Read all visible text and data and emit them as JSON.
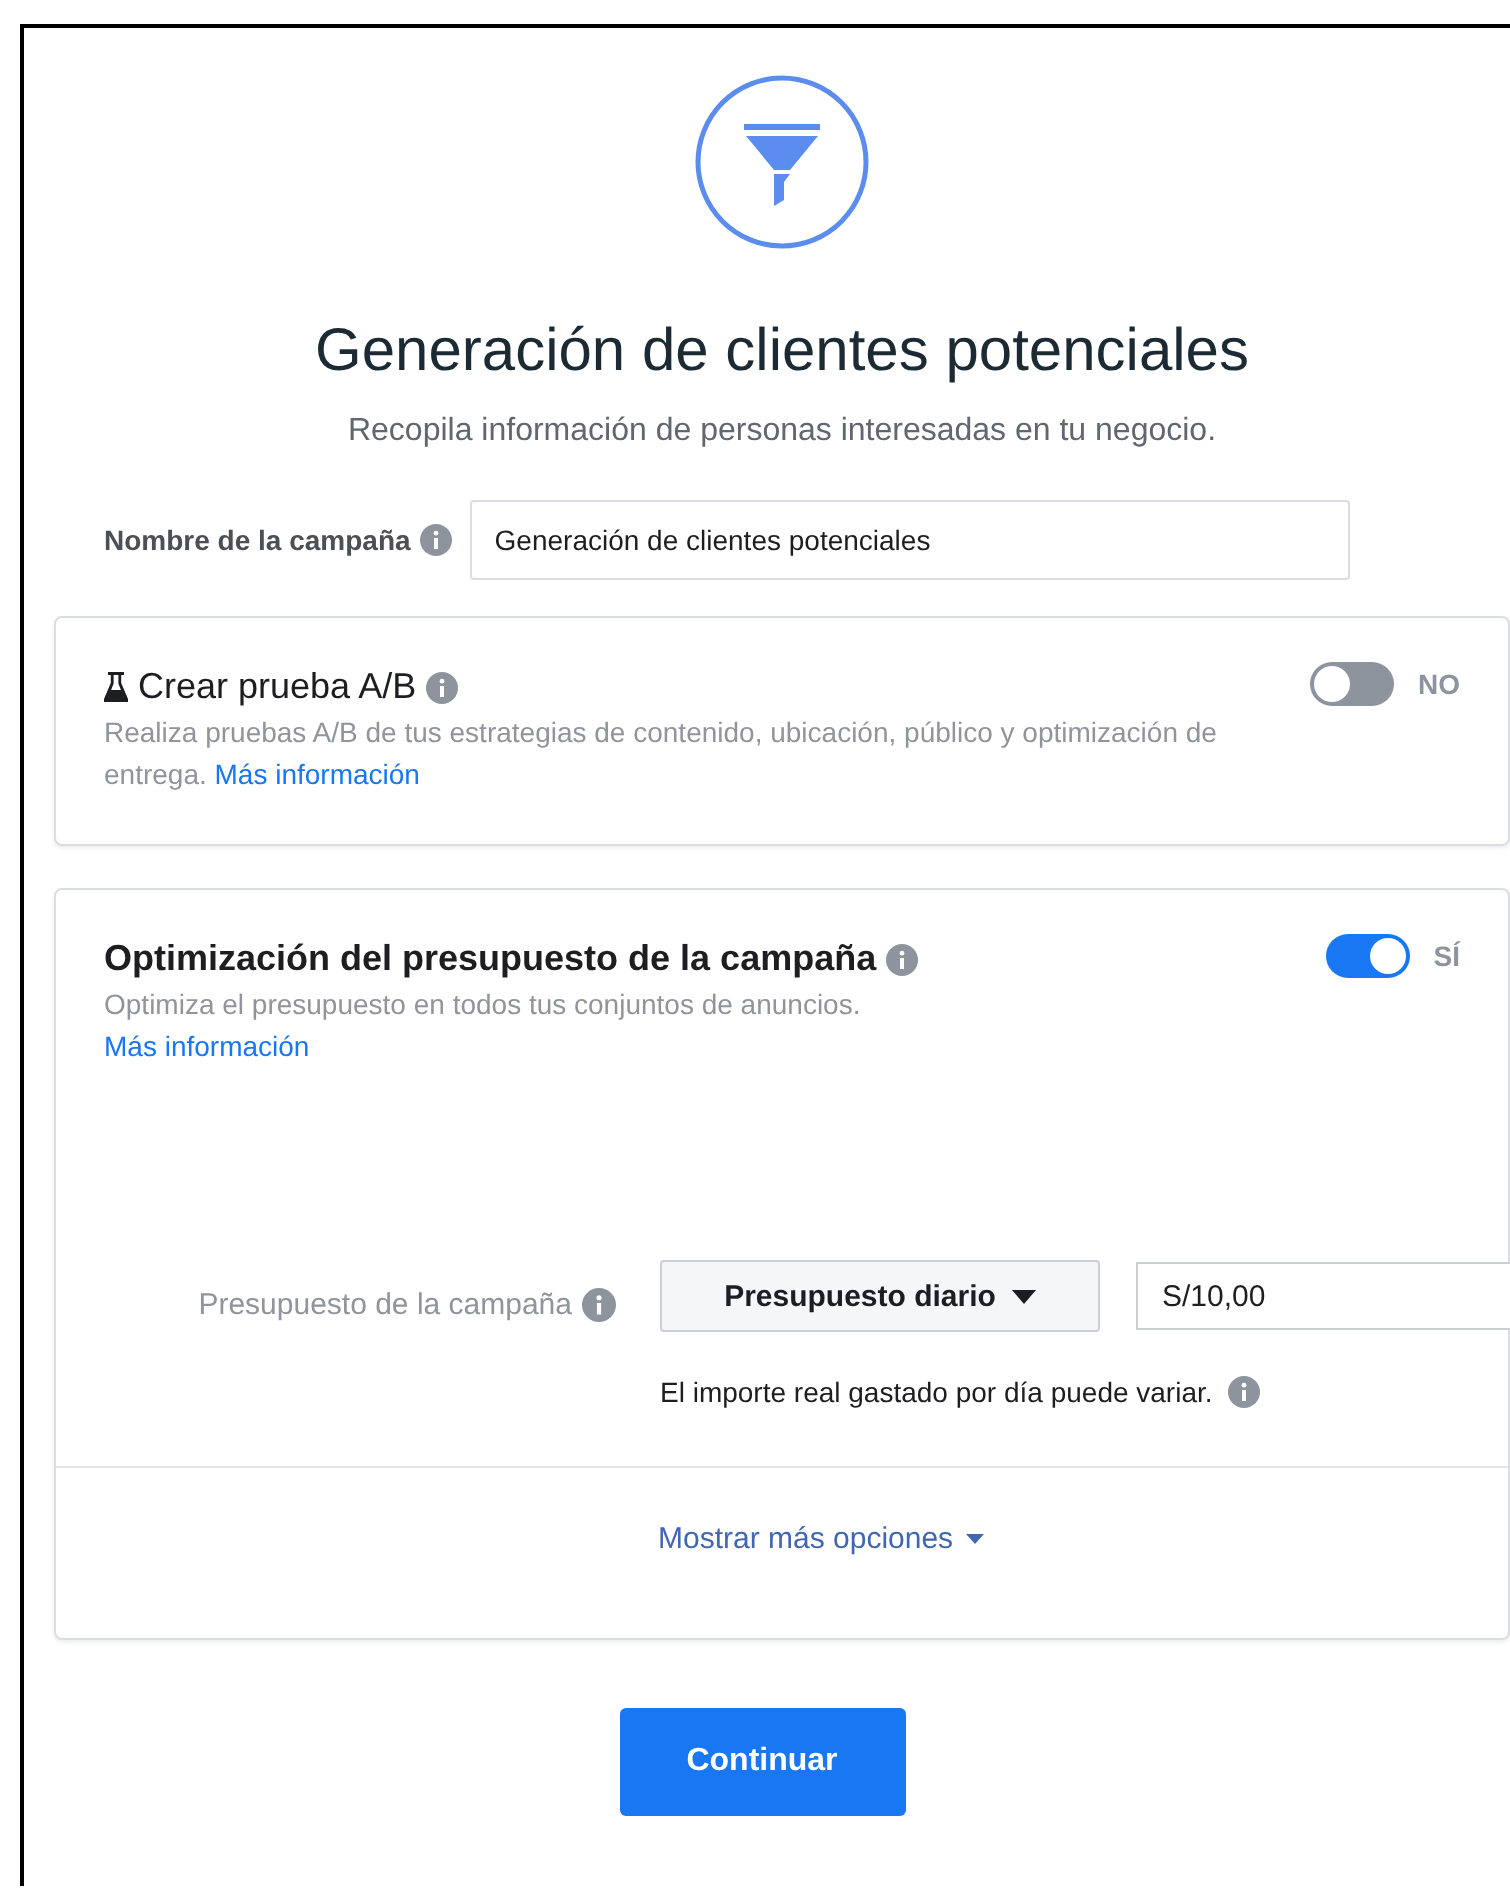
{
  "header": {
    "title": "Generación de clientes potenciales",
    "subtitle": "Recopila información de personas interesadas en tu negocio."
  },
  "campaign_name": {
    "label": "Nombre de la campaña",
    "value": "Generación de clientes potenciales"
  },
  "sections": [
    {
      "kind": "ab_test",
      "title": "Crear prueba A/B",
      "description": "Realiza pruebas A/B de tus estrategias de contenido, ubicación, público y optimización de entrega.",
      "link": "Más información",
      "toggle": {
        "on": false,
        "label": "NO"
      }
    },
    {
      "kind": "budget_optimization",
      "title": "Optimización del presupuesto de la campaña",
      "description": "Optimiza el presupuesto en todos tus conjuntos de anuncios.",
      "link": "Más información",
      "toggle": {
        "on": true,
        "label": "SÍ"
      },
      "budget": {
        "label": "Presupuesto de la campaña",
        "type": "Presupuesto diario",
        "amount": "S/10,00",
        "note": "El importe real gastado por día puede variar."
      },
      "more_options": "Mostrar más opciones"
    }
  ],
  "continue_button": "Continuar"
}
